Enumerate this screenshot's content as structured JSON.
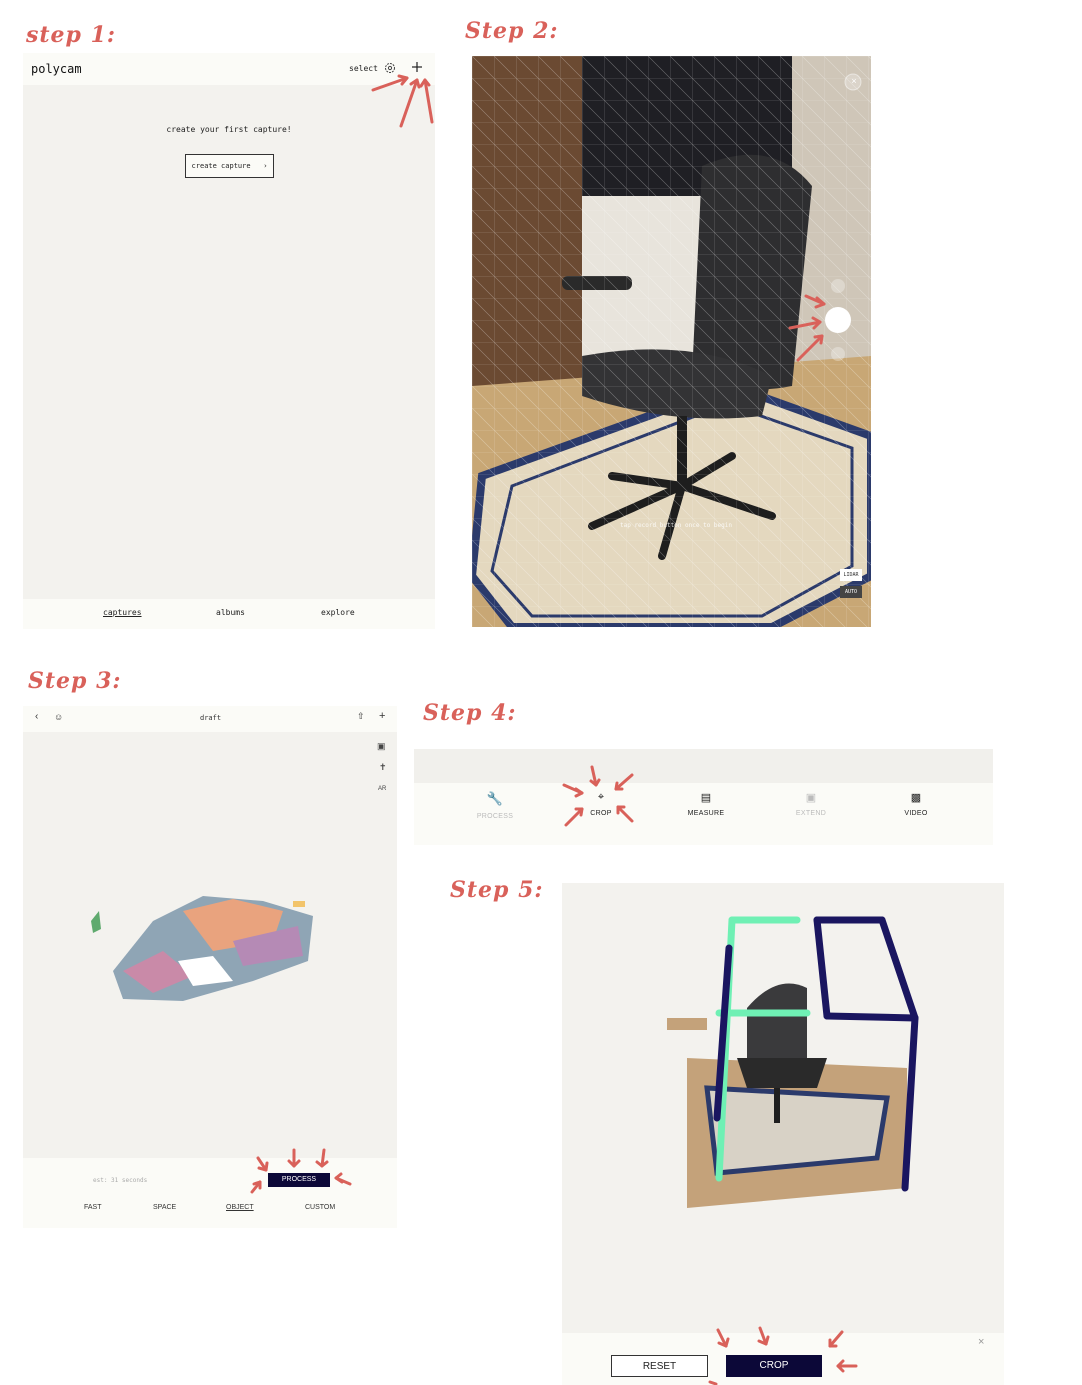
{
  "steps": {
    "step1": "step 1:",
    "step2": "Step 2:",
    "step3": "Step 3:",
    "step4": "Step 4:",
    "step5": "Step 5:"
  },
  "step1": {
    "app_title": "polycam",
    "select_label": "select",
    "empty_message": "create your first capture!",
    "create_capture_label": "create capture",
    "tabs": [
      "captures",
      "albums",
      "explore"
    ],
    "active_tab": "captures"
  },
  "step2": {
    "hint": "tap record button once to begin",
    "badge_top": "LIDAR",
    "badge_bottom": "AUTO"
  },
  "step3": {
    "title": "draft",
    "estimate": "est: 31 seconds",
    "process_label": "PROCESS",
    "modes": [
      "FAST",
      "SPACE",
      "OBJECT",
      "CUSTOM"
    ],
    "active_mode": "OBJECT",
    "ar_label": "AR"
  },
  "step4": {
    "tools": [
      "PROCESS",
      "CROP",
      "MEASURE",
      "EXTEND",
      "VIDEO"
    ]
  },
  "step5": {
    "reset_label": "RESET",
    "crop_label": "CROP"
  },
  "colors": {
    "annotation": "#d9615a",
    "dark_button": "#0c0838",
    "panel_bg": "#f3f2ee",
    "crop_box_teal": "#6ff0b4",
    "crop_box_navy": "#1a1660"
  }
}
